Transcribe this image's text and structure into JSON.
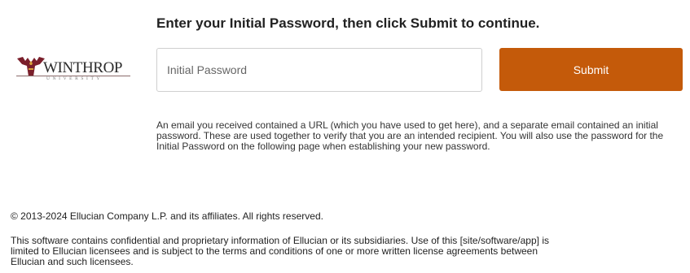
{
  "login": {
    "instruction": "Enter your Initial Password, then click Submit to continue.",
    "password_placeholder": "Initial Password",
    "submit_label": "Submit",
    "help_text": "An email you received contained a URL (which you have used to get here), and a separate email contained an initial password. These are used together to verify that you are an intended recipient. You will also use the password for the Initial Password on the following page when establishing your new password."
  },
  "logo": {
    "name": "WINTHROP",
    "subtitle": "UNIVERSITY",
    "icon": "eagle-logo-icon",
    "colors": {
      "maroon": "#7a1f2b",
      "gold": "#d8a33a"
    }
  },
  "footer": {
    "copyright": "© 2013-2024 Ellucian Company L.P. and its affiliates. All rights reserved.",
    "legal": "This software contains confidential and proprietary information of Ellucian or its subsidiaries. Use of this [site/software/app] is limited to Ellucian licensees and is subject to the terms and conditions of one or more written license agreements between Ellucian and such licensees."
  },
  "colors": {
    "submit": "#c45a0a",
    "input_border": "#cfcfcf"
  }
}
